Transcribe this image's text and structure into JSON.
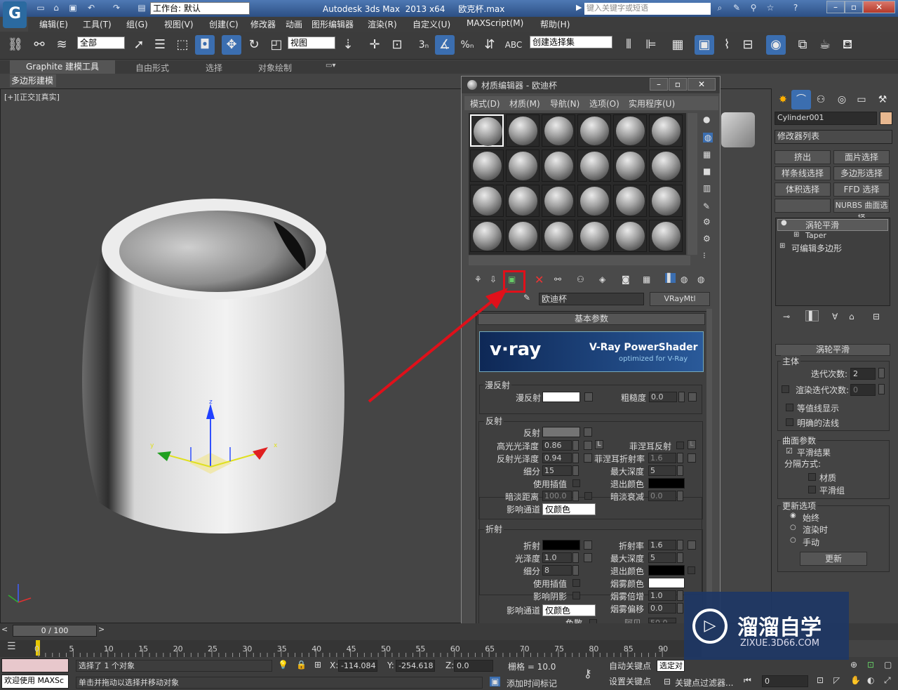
{
  "app": {
    "title": "Autodesk 3ds Max  2013 x64     欧克杯.max",
    "workspace": "工作台: 默认",
    "search_placeholder": "键入关键字或短语"
  },
  "menus": [
    "编辑(E)",
    "工具(T)",
    "组(G)",
    "视图(V)",
    "创建(C)",
    "修改器",
    "动画",
    "图形编辑器",
    "渲染(R)",
    "自定义(U)",
    "MAXScript(M)",
    "帮助(H)"
  ],
  "toolbar": {
    "selection_filter": "全部",
    "coord_system": "视图",
    "named_selection": "创建选择集"
  },
  "ribbon": {
    "tabs": [
      "Graphite 建模工具",
      "自由形式",
      "选择",
      "对象绘制"
    ],
    "subtab": "多边形建模"
  },
  "viewport": {
    "label": "[+][正交][真实]"
  },
  "material_editor": {
    "title": "材质编辑器 - 欧迪杯",
    "menus": [
      "模式(D)",
      "材质(M)",
      "导航(N)",
      "选项(O)",
      "实用程序(U)"
    ],
    "material_name": "欧迪杯",
    "material_type": "VRayMtl",
    "rollout": "基本参数",
    "banner": {
      "title": "V-Ray PowerShader",
      "subtitle": "optimized for V-Ray",
      "logo": "v·ray"
    },
    "diffuse": {
      "group": "漫反射",
      "label": "漫反射",
      "roughness_label": "粗糙度",
      "roughness": "0.0"
    },
    "reflection": {
      "group": "反射",
      "label": "反射",
      "hilight_gloss_label": "高光光泽度",
      "hilight_gloss": "0.86",
      "refl_gloss_label": "反射光泽度",
      "refl_gloss": "0.94",
      "subdivs_label": "细分",
      "subdivs": "15",
      "use_interp": "使用插值",
      "dim_dist_label": "暗淡距离",
      "dim_dist": "100.0",
      "affect_label": "影响通道",
      "affect": "仅颜色",
      "fresnel": "菲涅耳反射",
      "fresnel_ior_label": "菲涅耳折射率",
      "fresnel_ior": "1.6",
      "max_depth_label": "最大深度",
      "max_depth": "5",
      "exit_color": "退出颜色",
      "dim_falloff_label": "暗淡衰减",
      "dim_falloff": "0.0",
      "L": "L"
    },
    "refraction": {
      "group": "折射",
      "label": "折射",
      "gloss_label": "光泽度",
      "gloss": "1.0",
      "subdivs_label": "细分",
      "subdivs": "8",
      "use_interp": "使用插值",
      "affect_shadows": "影响阴影",
      "affect_label": "影响通道",
      "affect": "仅颜色",
      "dispersion": "色散",
      "ior_label": "折射率",
      "ior": "1.6",
      "max_depth_label": "最大深度",
      "max_depth": "5",
      "exit_color": "退出颜色",
      "fog_color": "烟雾颜色",
      "fog_mult_label": "烟雾倍增",
      "fog_mult": "1.0",
      "fog_bias_label": "烟雾偏移",
      "fog_bias": "0.0",
      "abbe_label": "阿贝",
      "abbe": "50.0"
    }
  },
  "command_panel": {
    "object_name": "Cylinder001",
    "modifier_list": "修改器列表",
    "buttons": [
      "挤出",
      "面片选择",
      "样条线选择",
      "多边形选择",
      "体积选择",
      "FFD 选择",
      "",
      "NURBS 曲面选择"
    ],
    "stack": [
      "涡轮平滑",
      "Taper",
      "可编辑多边形"
    ],
    "rollout_title": "涡轮平滑",
    "main_group": "主体",
    "iterations_label": "迭代次数:",
    "iterations": "2",
    "render_iters_label": "渲染迭代次数:",
    "render_iters": "0",
    "isoline": "等值线显示",
    "explicit_normals": "明确的法线",
    "surface_group": "曲面参数",
    "smooth_result": "平滑结果",
    "separate_by": "分隔方式:",
    "materials": "材质",
    "smoothing_groups": "平滑组",
    "update_group": "更新选项",
    "always": "始终",
    "when_rendering": "渲染时",
    "manually": "手动",
    "update_btn": "更新"
  },
  "timeline": {
    "frame": "0 / 100",
    "ticks": [
      "0",
      "5",
      "10",
      "15",
      "20",
      "25",
      "30",
      "35",
      "40",
      "45",
      "50",
      "55",
      "60",
      "65",
      "70",
      "75",
      "80",
      "85",
      "90"
    ]
  },
  "status": {
    "welcome": "欢迎使用 MAXSc",
    "selected": "选择了 1 个对象",
    "prompt": "单击并拖动以选择并移动对象",
    "x": "-114.084",
    "y": "-254.618",
    "z": "0.0",
    "grid": "栅格 = 10.0",
    "add_time_tag": "添加时间标记",
    "auto_key": "自动关键点",
    "set_key": "设置关键点",
    "selected_obj": "选定对",
    "key_filters": "关键点过滤器...",
    "frame_field": "0"
  },
  "watermark": {
    "text": "溜溜自学",
    "url": "ZIXUE.3D66.COM"
  }
}
